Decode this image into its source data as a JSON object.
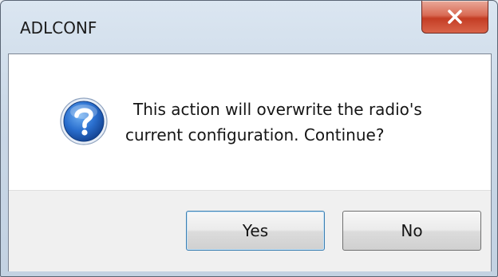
{
  "window": {
    "title": "ADLCONF",
    "close_icon": "close-x-icon"
  },
  "dialog": {
    "icon": "question-icon",
    "message_line1": "This action will overwrite the radio's",
    "message_line2": "current configuration. Continue?"
  },
  "buttons": {
    "yes_label": "Yes",
    "no_label": "No"
  },
  "colors": {
    "close_button": "#c43d24",
    "question_icon": "#1f5fb6"
  }
}
